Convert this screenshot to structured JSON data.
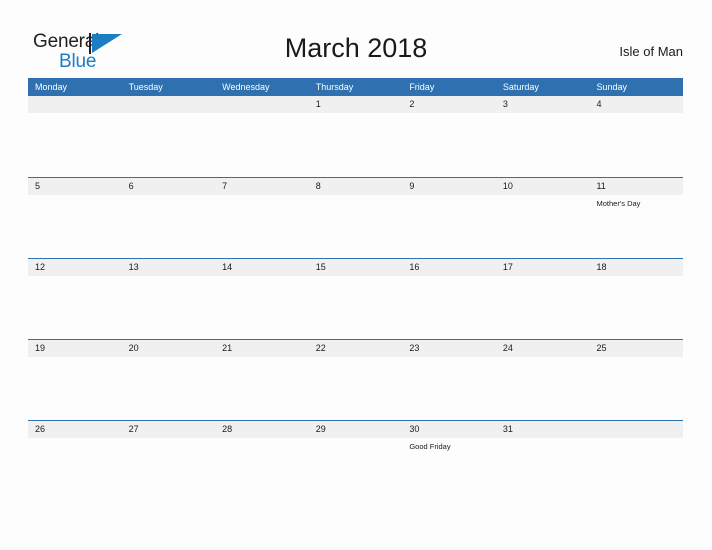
{
  "brand": {
    "name_part1": "General",
    "name_part2": "Blue",
    "flag_icon": "blue-flag-triangle",
    "accent_color": "#1b7ec2"
  },
  "header": {
    "title": "March 2018",
    "locale": "Isle of Man"
  },
  "theme": {
    "header_blue": "#2e70b0",
    "band_gray": "#f0f0f0",
    "page_bg": "#fdfdfd",
    "text": "#1a1a1a"
  },
  "calendar": {
    "month": "March",
    "year": "2018",
    "weekday_headers": [
      "Monday",
      "Tuesday",
      "Wednesday",
      "Thursday",
      "Friday",
      "Saturday",
      "Sunday"
    ],
    "weeks": [
      [
        {
          "day": "",
          "events": []
        },
        {
          "day": "",
          "events": []
        },
        {
          "day": "",
          "events": []
        },
        {
          "day": "1",
          "events": []
        },
        {
          "day": "2",
          "events": []
        },
        {
          "day": "3",
          "events": []
        },
        {
          "day": "4",
          "events": []
        }
      ],
      [
        {
          "day": "5",
          "events": []
        },
        {
          "day": "6",
          "events": []
        },
        {
          "day": "7",
          "events": []
        },
        {
          "day": "8",
          "events": []
        },
        {
          "day": "9",
          "events": []
        },
        {
          "day": "10",
          "events": []
        },
        {
          "day": "11",
          "events": [
            "Mother's Day"
          ]
        }
      ],
      [
        {
          "day": "12",
          "events": []
        },
        {
          "day": "13",
          "events": []
        },
        {
          "day": "14",
          "events": []
        },
        {
          "day": "15",
          "events": []
        },
        {
          "day": "16",
          "events": []
        },
        {
          "day": "17",
          "events": []
        },
        {
          "day": "18",
          "events": []
        }
      ],
      [
        {
          "day": "19",
          "events": []
        },
        {
          "day": "20",
          "events": []
        },
        {
          "day": "21",
          "events": []
        },
        {
          "day": "22",
          "events": []
        },
        {
          "day": "23",
          "events": []
        },
        {
          "day": "24",
          "events": []
        },
        {
          "day": "25",
          "events": []
        }
      ],
      [
        {
          "day": "26",
          "events": []
        },
        {
          "day": "27",
          "events": []
        },
        {
          "day": "28",
          "events": []
        },
        {
          "day": "29",
          "events": []
        },
        {
          "day": "30",
          "events": [
            "Good Friday"
          ]
        },
        {
          "day": "31",
          "events": []
        },
        {
          "day": "",
          "events": []
        }
      ]
    ]
  }
}
